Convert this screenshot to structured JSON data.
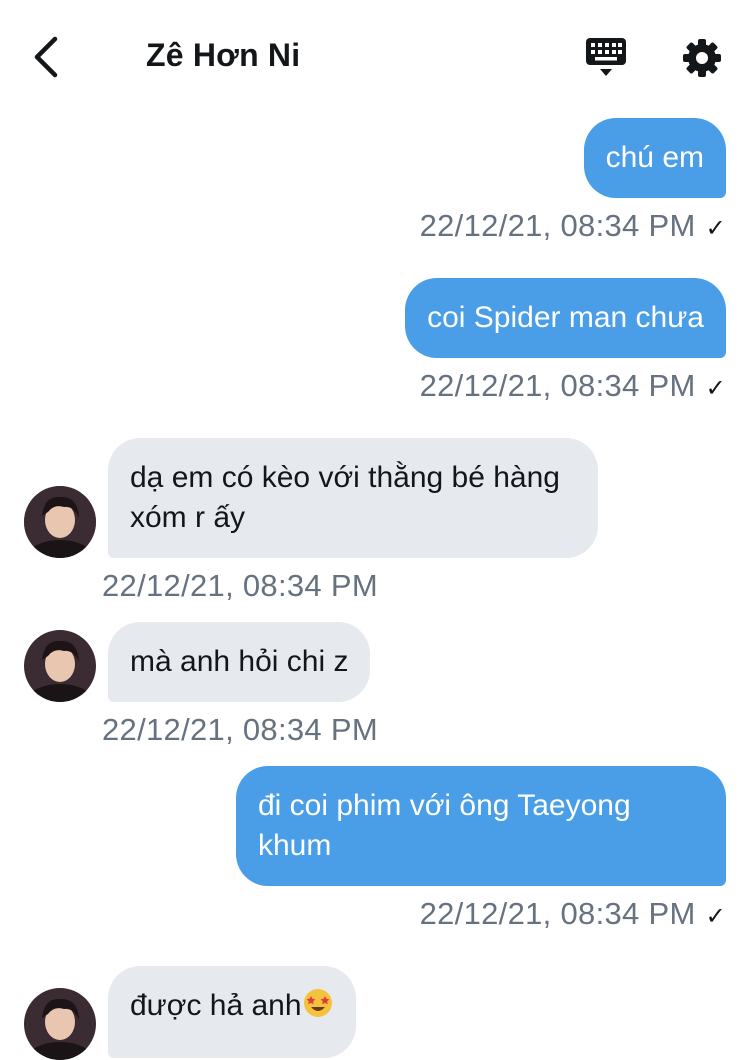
{
  "header": {
    "title": "Zê Hơn Ni",
    "back_icon": "chevron-left-icon",
    "keyboard_icon": "keyboard-icon",
    "settings_icon": "gear-icon"
  },
  "colors": {
    "outgoing_bubble": "#4a9ee8",
    "incoming_bubble": "#e6e9ee",
    "timestamp": "#66727f"
  },
  "messages": [
    {
      "direction": "out",
      "text": "chú em",
      "time": "22/12/21, 08:34 PM",
      "read_check": "✓"
    },
    {
      "direction": "out",
      "text": "coi Spider man chưa",
      "time": "22/12/21, 08:34 PM",
      "read_check": "✓"
    },
    {
      "direction": "in",
      "text": "dạ em có kèo với thằng bé hàng xóm r ấy",
      "time": "22/12/21, 08:34 PM"
    },
    {
      "direction": "in",
      "text": "mà anh hỏi chi z",
      "time": "22/12/21, 08:34 PM"
    },
    {
      "direction": "out",
      "text": "đi coi phim với ông Taeyong khum",
      "time": "22/12/21, 08:34 PM",
      "read_check": "✓"
    },
    {
      "direction": "in",
      "text": "được hả anh",
      "emoji": "star-struck-emoji"
    }
  ]
}
